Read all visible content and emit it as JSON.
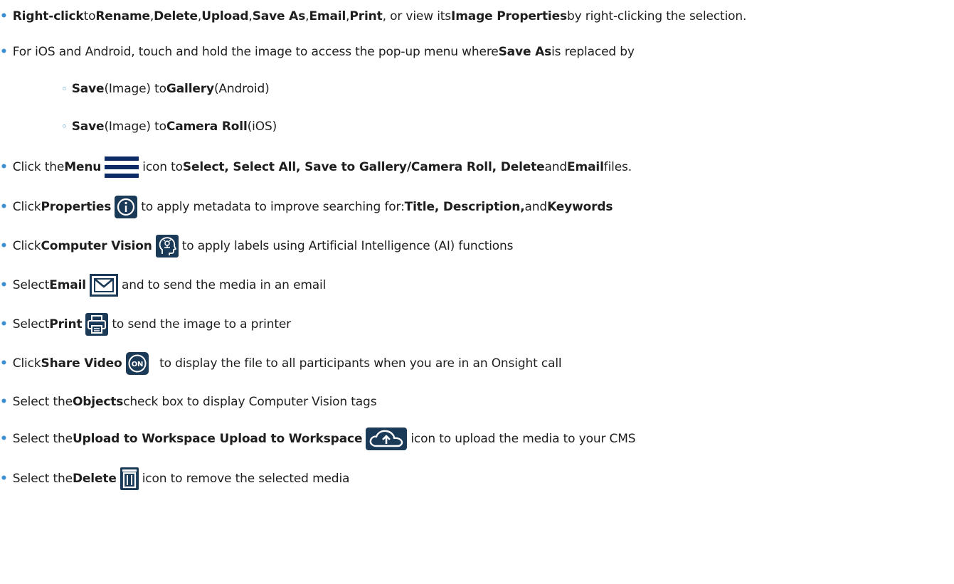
{
  "colors": {
    "bullet": "#3c8fd1",
    "icon_bg": "#1b3a57",
    "icon_menu": "#0d2a66"
  },
  "items": [
    {
      "pre": "",
      "b1": "Right-click",
      "t1": " to ",
      "b2": "Rename",
      "t2": ", ",
      "b3": "Delete",
      "t3": ", ",
      "b4": "Upload",
      "t4": ", ",
      "b5": "Save As",
      "t5": ", ",
      "b6": "Email",
      "t6": ", ",
      "b7": "Print",
      "t7": ", or view its ",
      "b8": "Image Properties",
      "t8": " by right-clicking the selection."
    },
    {
      "text": "For iOS and Android, touch and hold the image to access the pop-up menu where ",
      "b1": "Save As",
      "t1": " is replaced by"
    },
    {
      "b1": "Save",
      "t1": " (Image) to ",
      "b2": "Gallery",
      "t2": " (Android)"
    },
    {
      "b1": "Save",
      "t1": " (Image) to ",
      "b2": "Camera Roll",
      "t2": " (iOS)"
    },
    {
      "pre": "Click the ",
      "b1": "Menu",
      "icon": "menu-icon",
      "t1": " icon to ",
      "b2": "Select, Select All, Save to Gallery/Camera Roll, Delete",
      "t2": " and ",
      "b3": "Email",
      "t3": " files."
    },
    {
      "pre": "Click ",
      "b1": "Properties",
      "icon": "info-icon",
      "t1": " to apply metadata to improve searching for: ",
      "b2": "Title, Description,",
      "t2": " and ",
      "b3": "Keywords"
    },
    {
      "pre": "Click ",
      "b1": "Computer Vision",
      "icon": "ai-head-icon",
      "t1": " to apply labels using Artificial Intelligence (AI) functions"
    },
    {
      "pre": "Select ",
      "b1": "Email",
      "icon": "envelope-icon",
      "t1": " and to send the media in an email"
    },
    {
      "pre": "Select ",
      "b1": "Print",
      "icon": "printer-icon",
      "t1": " to send the image to a printer"
    },
    {
      "pre": "Click ",
      "b1": "Share Video",
      "icon": "onsight-icon",
      "t1": "  to display the file to all participants when you are in an Onsight call"
    },
    {
      "pre": "Select the ",
      "b1": "Objects",
      "t1": " check box to display Computer Vision tags"
    },
    {
      "pre": "Select the ",
      "b1": "Upload to Workspace Upload to Workspace",
      "icon": "cloud-upload-icon",
      "t1": " icon to upload the media to your CMS"
    },
    {
      "pre": "Select the ",
      "b1": "Delete",
      "icon": "trash-icon",
      "t1": " icon to remove the selected media"
    }
  ]
}
